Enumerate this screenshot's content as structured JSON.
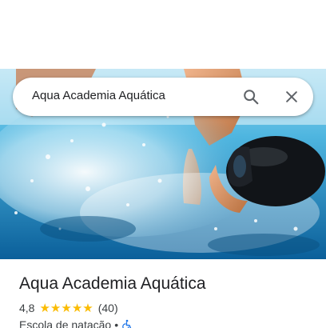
{
  "search": {
    "query": "Aqua Academia Aquática"
  },
  "place": {
    "name": "Aqua Academia Aquática",
    "rating": "4,8",
    "stars": 5,
    "review_count": "(40)",
    "category": "Escola de natação",
    "separator": "•"
  },
  "icons": {
    "search": "search-icon",
    "close": "close-icon",
    "star": "star-icon",
    "accessibility": "wheelchair-accessible-icon"
  },
  "colors": {
    "star": "#fbbc04",
    "accessibility": "#1a73e8",
    "text_primary": "#202124",
    "text_secondary": "#3c4043"
  }
}
